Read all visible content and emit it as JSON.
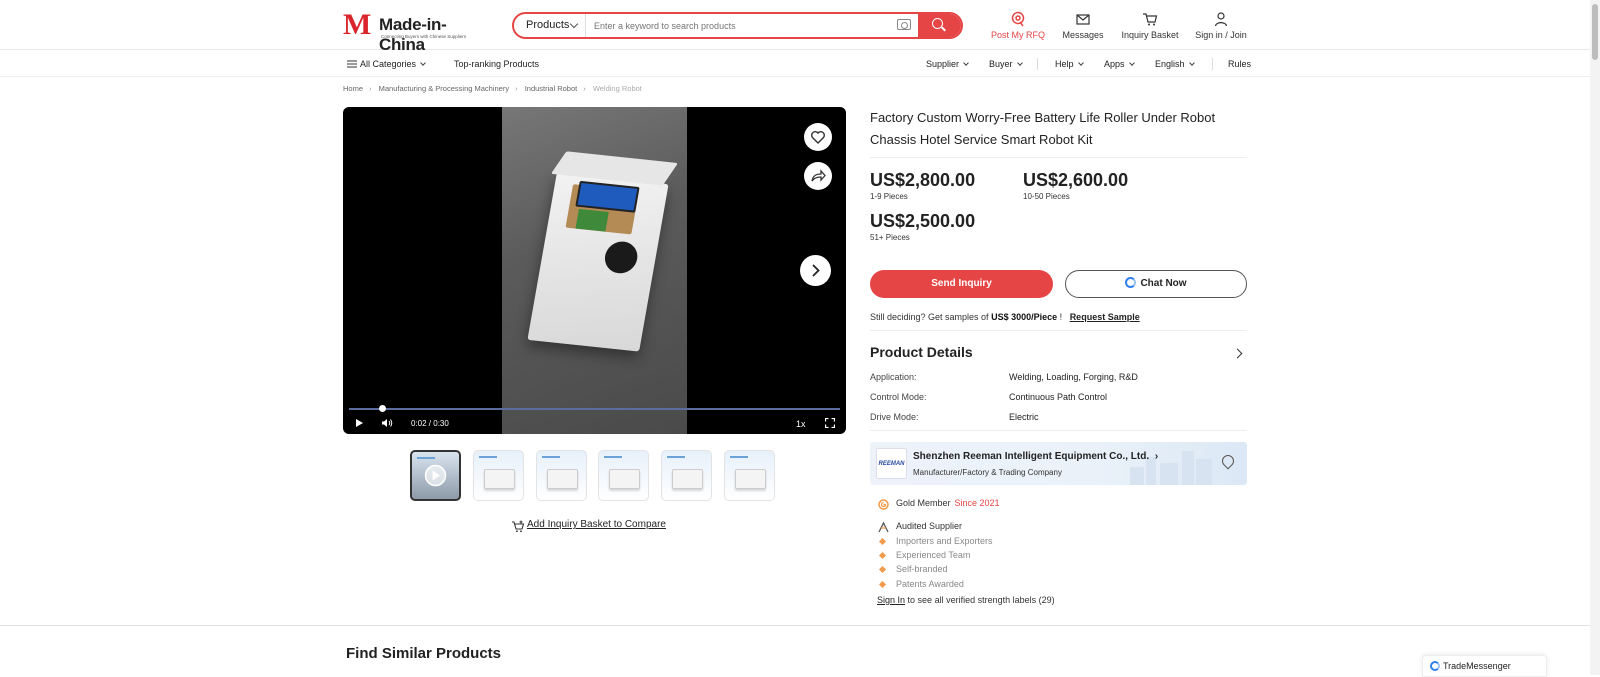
{
  "header": {
    "logo_text": "Made-in-China",
    "logo_tagline": "Connecting Buyers with Chinese Suppliers",
    "search": {
      "category": "Products",
      "placeholder": "Enter a keyword to search products"
    },
    "actions": [
      {
        "label": "Post My RFQ",
        "icon": "rfq-icon",
        "color": "#e64545"
      },
      {
        "label": "Messages",
        "icon": "mail-icon"
      },
      {
        "label": "Inquiry Basket",
        "icon": "cart-icon"
      },
      {
        "label": "Sign in / Join",
        "icon": "user-icon"
      }
    ]
  },
  "nav": {
    "all_categories": "All Categories",
    "top_ranking": "Top-ranking Products",
    "supplier": "Supplier",
    "buyer": "Buyer",
    "help": "Help",
    "apps": "Apps",
    "language": "English",
    "rules": "Rules"
  },
  "breadcrumb": [
    "Home",
    "Manufacturing & Processing Machinery",
    "Industrial Robot",
    "Welding Robot"
  ],
  "video": {
    "time": "0:02 / 0:30",
    "speed": "1x",
    "progress": 0.067
  },
  "thumbnails_count": 6,
  "compare_label": "Add Inquiry Basket to Compare",
  "product": {
    "title": "Factory Custom Worry-Free Battery Life Roller Under Robot Chassis Hotel Service Smart Robot Kit",
    "prices": [
      {
        "price": "US$2,800.00",
        "qty": "1-9 Pieces"
      },
      {
        "price": "US$2,600.00",
        "qty": "10-50 Pieces"
      },
      {
        "price": "US$2,500.00",
        "qty": "51+ Pieces"
      }
    ],
    "send_inquiry": "Send Inquiry",
    "chat_now": "Chat Now",
    "sample": {
      "prefix": "Still deciding? Get samples of",
      "amount": "US$ 3000/Piece",
      "bang": "!",
      "link": "Request Sample"
    },
    "details_title": "Product Details",
    "attributes": [
      {
        "key": "Application:",
        "value": "Welding, Loading, Forging, R&D"
      },
      {
        "key": "Control Mode:",
        "value": "Continuous Path Control"
      },
      {
        "key": "Drive Mode:",
        "value": "Electric"
      }
    ]
  },
  "supplier": {
    "logo_text": "REEMAN",
    "name": "Shenzhen Reeman Intelligent Equipment Co., Ltd.",
    "type": "Manufacturer/Factory & Trading Company",
    "membership": "Gold Member",
    "since": "Since 2021",
    "audited": "Audited Supplier",
    "labels": [
      "Importers and Exporters",
      "Experienced Team",
      "Self-branded",
      "Patents Awarded"
    ],
    "signin_link": "Sign In",
    "signin_text": "to see all verified strength labels (29)"
  },
  "similar_title": "Find Similar Products",
  "trade_messenger": "TradeMessenger",
  "colors": {
    "accent": "#e64545",
    "gold": "#f29a4b",
    "chat_blue": "#2f80ed"
  }
}
